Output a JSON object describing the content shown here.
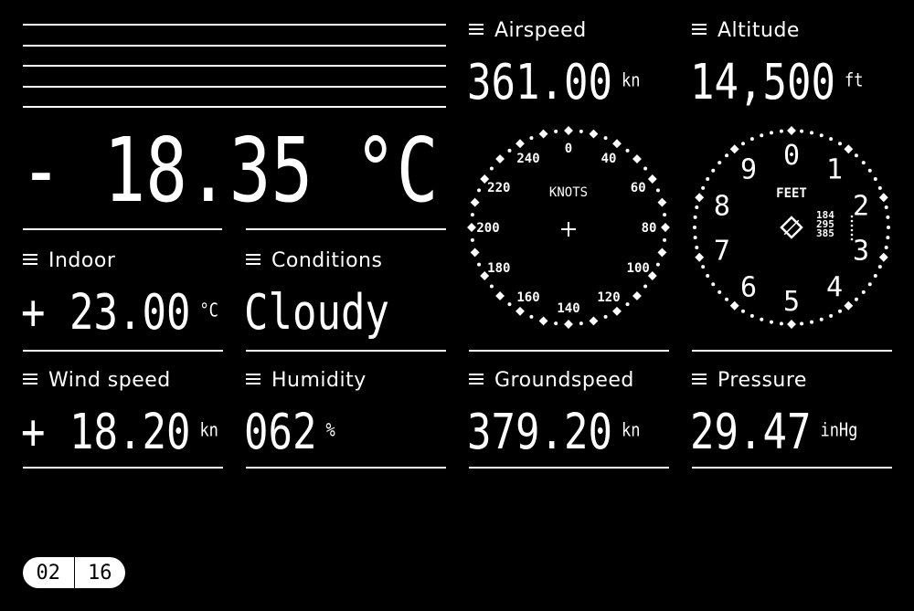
{
  "temperature": {
    "value": "- 18.35 °C"
  },
  "tiles": [
    {
      "id": "indoor",
      "label": "Indoor",
      "value": "+ 23.00",
      "unit": "°C"
    },
    {
      "id": "conditions",
      "label": "Conditions",
      "value": "Cloudy",
      "unit": ""
    },
    {
      "id": "wind",
      "label": "Wind speed",
      "value": "+ 18.20",
      "unit": "kn"
    },
    {
      "id": "humidity",
      "label": "Humidity",
      "value": "062",
      "unit": "%"
    },
    {
      "id": "airspeed",
      "label": "Airspeed",
      "value": "361.00",
      "unit": "kn"
    },
    {
      "id": "altitude",
      "label": "Altitude",
      "value": "14,500",
      "unit": "ft"
    },
    {
      "id": "groundspeed",
      "label": "Groundspeed",
      "value": "379.20",
      "unit": "kn"
    },
    {
      "id": "pressure",
      "label": "Pressure",
      "value": "29.47",
      "unit": "inHg"
    }
  ],
  "airspeed_gauge": {
    "title": "KNOTS",
    "labels": [
      "0",
      "40",
      "60",
      "80",
      "100",
      "120",
      "140",
      "160",
      "180",
      "200",
      "220",
      "240"
    ]
  },
  "altimeter_gauge": {
    "title": "FEET",
    "labels": [
      "0",
      "1",
      "2",
      "3",
      "4",
      "5",
      "6",
      "7",
      "8",
      "9"
    ],
    "drum": [
      "184",
      "295",
      "385"
    ]
  },
  "pager": {
    "current": "02",
    "total": "16"
  },
  "icons": {
    "menu": "hamburger-icon",
    "crosshair": "plus-icon",
    "diamond": "diamond-icon"
  }
}
